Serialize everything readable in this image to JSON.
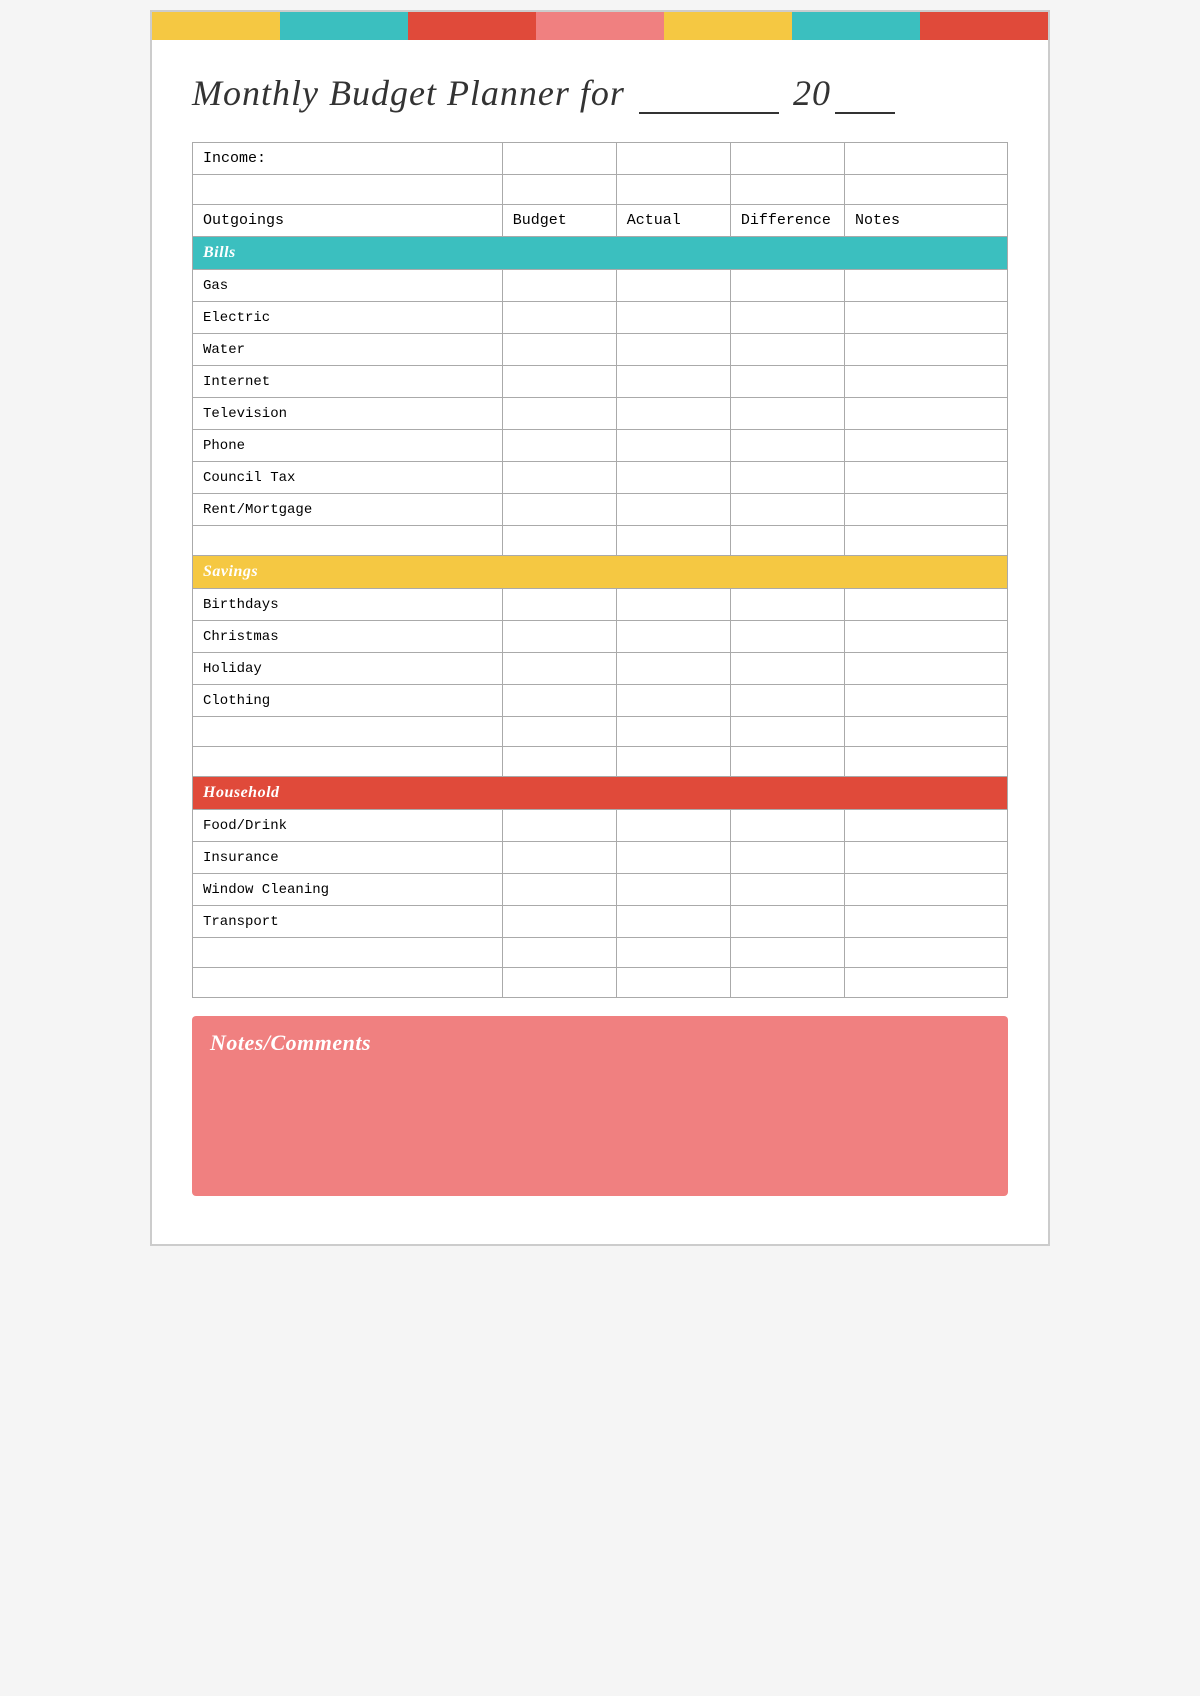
{
  "colorBar": {
    "segments": [
      "yellow",
      "teal",
      "red",
      "pink",
      "yellow2",
      "teal2",
      "red2"
    ]
  },
  "title": {
    "text": "Monthly Budget Planner for",
    "year_prefix": "20"
  },
  "table": {
    "income_label": "Income:",
    "headers": {
      "outgoings": "Outgoings",
      "budget": "Budget",
      "actual": "Actual",
      "difference": "Difference",
      "notes": "Notes"
    },
    "sections": [
      {
        "name": "Bills",
        "color": "teal",
        "items": [
          "Gas",
          "Electric",
          "Water",
          "Internet",
          "Television",
          "Phone",
          "Council Tax",
          "Rent/Mortgage"
        ]
      },
      {
        "name": "Savings",
        "color": "savings",
        "items": [
          "Birthdays",
          "Christmas",
          "Holiday",
          "Clothing"
        ]
      },
      {
        "name": "Household",
        "color": "household",
        "items": [
          "Food/Drink",
          "Insurance",
          "Window Cleaning",
          "Transport"
        ]
      }
    ]
  },
  "notes": {
    "label": "Notes/Comments"
  }
}
